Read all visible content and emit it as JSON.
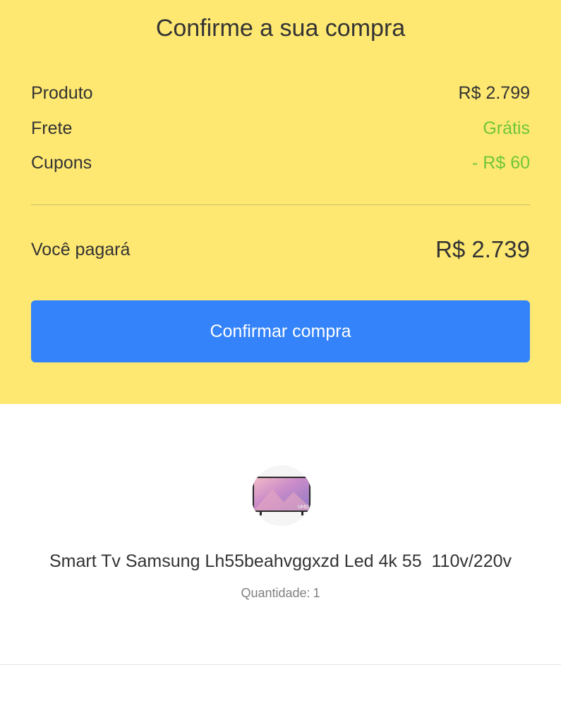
{
  "summary": {
    "title": "Confirme a sua compra",
    "rows": [
      {
        "label": "Produto",
        "value": "R$ 2.799"
      },
      {
        "label": "Frete",
        "value": "Grátis"
      },
      {
        "label": "Cupons",
        "value": "- R$ 60"
      }
    ],
    "total_label": "Você pagará",
    "total_value": "R$ 2.739",
    "confirm_button": "Confirmar compra"
  },
  "product": {
    "name": "Smart Tv Samsung Lh55beahvggxzd Led 4k 55  110v/220v",
    "quantity_label": "Quantidade:",
    "quantity_value": "1",
    "image_icon": "tv-product-image"
  },
  "colors": {
    "header_background": "#FEE872",
    "accent_blue": "#3483FA",
    "success_green": "#6EC639"
  }
}
